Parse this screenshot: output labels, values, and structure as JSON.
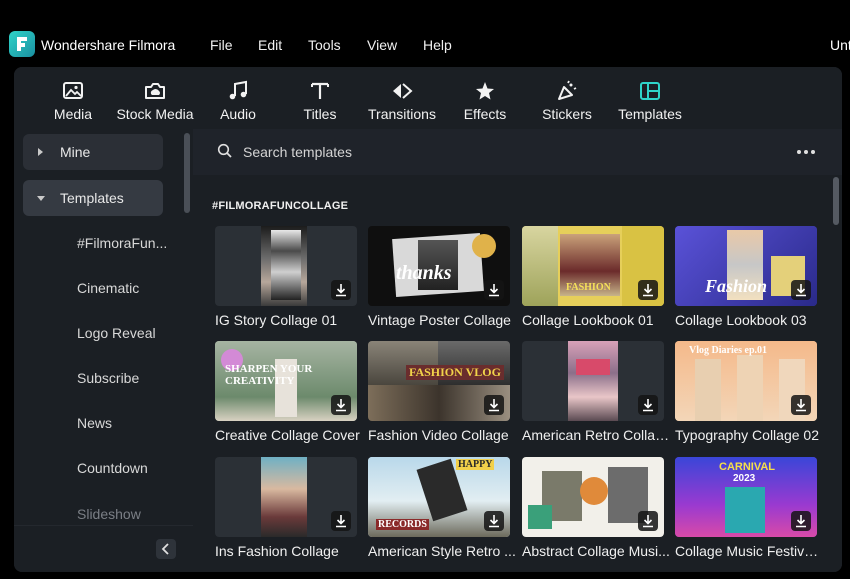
{
  "app": {
    "name": "Wondershare Filmora",
    "window_title": "Untitled",
    "menu": [
      "File",
      "Edit",
      "Tools",
      "View",
      "Help"
    ]
  },
  "toolbar": {
    "items": [
      {
        "label": "Media",
        "icon": "media-icon"
      },
      {
        "label": "Stock Media",
        "icon": "stock-media-icon"
      },
      {
        "label": "Audio",
        "icon": "music-note-icon"
      },
      {
        "label": "Titles",
        "icon": "titles-icon"
      },
      {
        "label": "Transitions",
        "icon": "transitions-icon"
      },
      {
        "label": "Effects",
        "icon": "effects-icon"
      },
      {
        "label": "Stickers",
        "icon": "stickers-icon"
      },
      {
        "label": "Templates",
        "icon": "templates-icon"
      }
    ],
    "active": "Templates"
  },
  "sidebar": {
    "groups": [
      {
        "label": "Mine",
        "expanded": false
      },
      {
        "label": "Templates",
        "expanded": true
      }
    ],
    "sub_items": [
      "#FilmoraFun...",
      "Cinematic",
      "Logo Reveal",
      "Subscribe",
      "News",
      "Countdown",
      "Slideshow"
    ]
  },
  "search": {
    "placeholder": "Search templates"
  },
  "section": {
    "title": "#FILMORAFUNCOLLAGE"
  },
  "templates": [
    {
      "label": "IG Story Collage 01"
    },
    {
      "label": "Vintage Poster Collage"
    },
    {
      "label": "Collage Lookbook 01"
    },
    {
      "label": "Collage Lookbook 03"
    },
    {
      "label": "Creative Collage Cover"
    },
    {
      "label": "Fashion Video Collage"
    },
    {
      "label": "American Retro Collag..."
    },
    {
      "label": "Typography Collage 02"
    },
    {
      "label": "Ins Fashion Collage"
    },
    {
      "label": "American Style Retro ..."
    },
    {
      "label": "Abstract Collage Musi..."
    },
    {
      "label": "Collage Music Festival..."
    }
  ],
  "thumb_text": {
    "thanks": "thanks",
    "fashion": "FASHION",
    "fashion_script": "Fashion",
    "creativity": "SHARPEN YOUR CREATIVITY",
    "fashion_vlog": "FASHION VLOG",
    "vlog_diaries": "Vlog Diaries ep.01",
    "happy": "HAPPY",
    "records": "RECORDS",
    "carnival": "CARNIVAL",
    "carnival_year": "2023"
  },
  "colors": {
    "accent": "#2fd4c9",
    "panel": "#1b1f24",
    "selected": "#353a42"
  }
}
